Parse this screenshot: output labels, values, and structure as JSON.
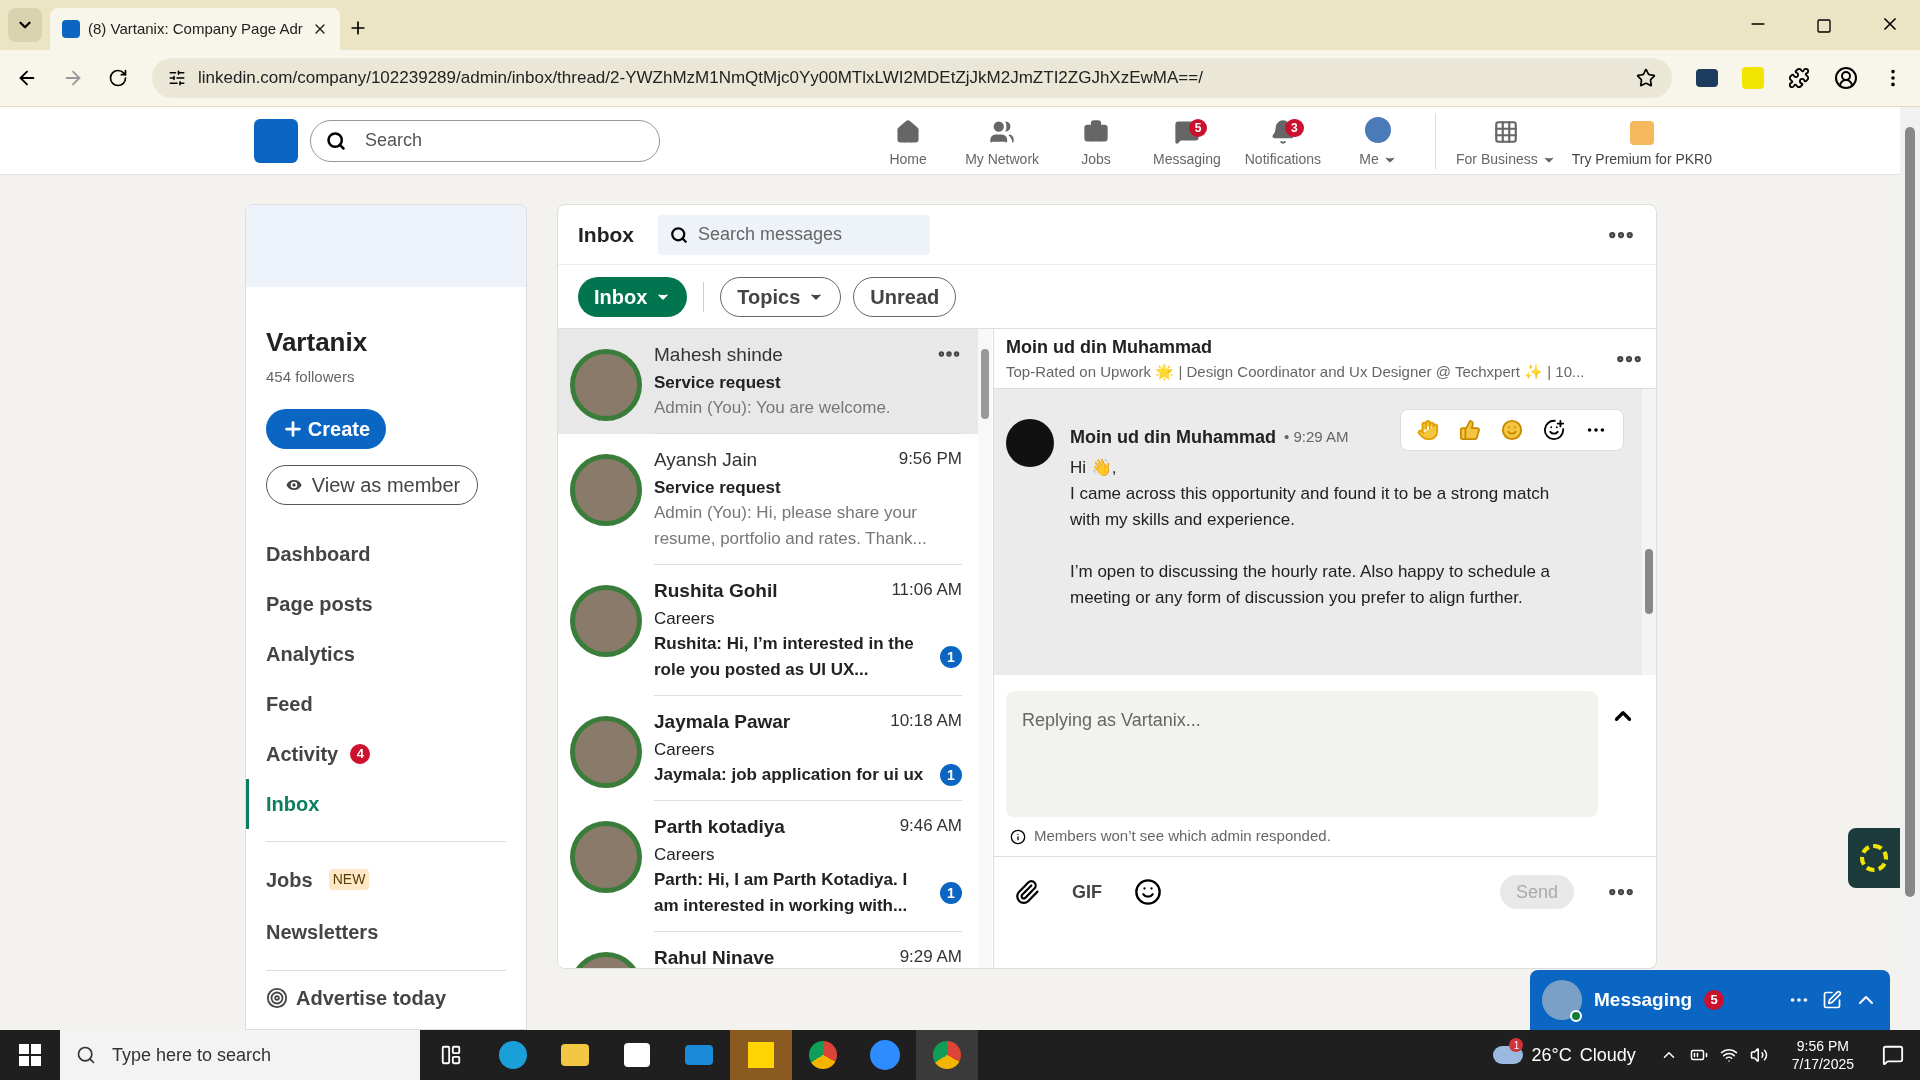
{
  "browser": {
    "tab_title": "(8) Vartanix: Company Page Adr",
    "url": "linkedin.com/company/102239289/admin/inbox/thread/2-YWZhMzM1NmQtMjc0Yy00MTlxLWI2MDEtZjJkM2JmZTI2ZGJhXzEwMA==/"
  },
  "nav": {
    "search_placeholder": "Search",
    "items": [
      {
        "kind": "home",
        "label": "Home"
      },
      {
        "kind": "network",
        "label": "My Network"
      },
      {
        "kind": "jobs",
        "label": "Jobs"
      },
      {
        "kind": "messaging",
        "label": "Messaging",
        "badge": "5"
      },
      {
        "kind": "notifications",
        "label": "Notifications",
        "badge": "3"
      },
      {
        "kind": "me",
        "label": "Me"
      }
    ],
    "for_business": "For Business",
    "premium": "Try Premium for PKR0"
  },
  "sidebar": {
    "name": "Vartanix",
    "followers": "454 followers",
    "create": "Create",
    "view_as_member": "View as member",
    "items": [
      {
        "label": "Dashboard",
        "selected": false
      },
      {
        "label": "Page posts",
        "selected": false
      },
      {
        "label": "Analytics",
        "selected": false
      },
      {
        "label": "Feed",
        "selected": false
      },
      {
        "label": "Activity",
        "selected": false,
        "badge": "4"
      },
      {
        "label": "Inbox",
        "selected": true
      }
    ],
    "items2": [
      {
        "label": "Jobs",
        "tag": "NEW"
      },
      {
        "label": "Newsletters"
      }
    ],
    "advertise": "Advertise today"
  },
  "inbox": {
    "title": "Inbox",
    "search_placeholder": "Search messages",
    "filters": [
      {
        "label": "Inbox",
        "kind": "dropdown",
        "selected": true
      },
      {
        "label": "Topics",
        "kind": "dropdown",
        "selected": false
      },
      {
        "label": "Unread",
        "kind": "toggle",
        "selected": false
      }
    ],
    "conversations": [
      {
        "name": "Mahesh shinde",
        "topic": "Service request",
        "preview": "Admin (You): You are welcome.",
        "unread": false,
        "selected": true
      },
      {
        "name": "Ayansh Jain",
        "time": "9:56 PM",
        "topic": "Service request",
        "preview": "Admin (You): Hi, please share your resume, portfolio and rates. Thank...",
        "unread": false,
        "selected": false
      },
      {
        "name": "Rushita Gohil",
        "time": "11:06 AM",
        "topic": "Careers",
        "preview": "Rushita: Hi, I’m interested in the role you posted as UI UX...",
        "unread": true,
        "count": "1",
        "selected": false
      },
      {
        "name": "Jaymala Pawar",
        "time": "10:18 AM",
        "topic": "Careers",
        "preview": "Jaymala: job application for ui ux",
        "unread": true,
        "count": "1",
        "selected": false
      },
      {
        "name": "Parth kotadiya",
        "time": "9:46 AM",
        "topic": "Careers",
        "preview": "Parth: Hi, I am Parth Kotadiya. I am interested in working with...",
        "unread": true,
        "count": "1",
        "selected": false
      },
      {
        "name": "Rahul Ninave",
        "time": "9:29 AM",
        "unread": true,
        "selected": false
      }
    ],
    "thread": {
      "name": "Moin ud din Muhammad",
      "headline": "Top-Rated on Upwork 🌟 | Design Coordinator and Ux Designer @ Techxpert ✨ | 10...",
      "message": {
        "sender": "Moin ud din Muhammad",
        "time": "• 9:29 AM",
        "paragraphs": [
          [
            "Hi 👋,",
            "I came across this opportunity and found it to be a strong match with my skills and experience."
          ],
          [
            "I’m open to discussing the hourly rate. Also happy to schedule a meeting or any form of discussion you prefer to align further."
          ]
        ]
      },
      "reply_placeholder": "Replying as Vartanix...",
      "notice": "Members won’t see which admin responded.",
      "gif": "GIF",
      "send": {
        "label": "Send",
        "disabled": true
      }
    }
  },
  "messaging_popup": {
    "label": "Messaging",
    "badge": "5"
  },
  "taskbar": {
    "search_placeholder": "Type here to search",
    "weather_badge": "1",
    "temperature": "26°C",
    "condition": "Cloudy",
    "time": "9:56 PM",
    "date": "7/17/2025"
  }
}
